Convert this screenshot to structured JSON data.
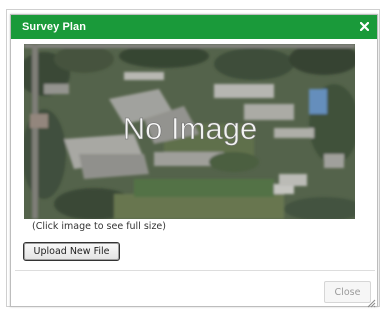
{
  "dialog": {
    "title": "Survey Plan",
    "close_symbol": "×",
    "image_overlay_text": "No Image",
    "caption": "(Click image to see full size)",
    "upload_button_label": "Upload New File",
    "close_button_label": "Close"
  },
  "colors": {
    "title_bar": "#1a9a3a",
    "title_text": "#ffffff"
  },
  "icons": {
    "close": "close-icon",
    "resize": "resize-grip-icon"
  }
}
